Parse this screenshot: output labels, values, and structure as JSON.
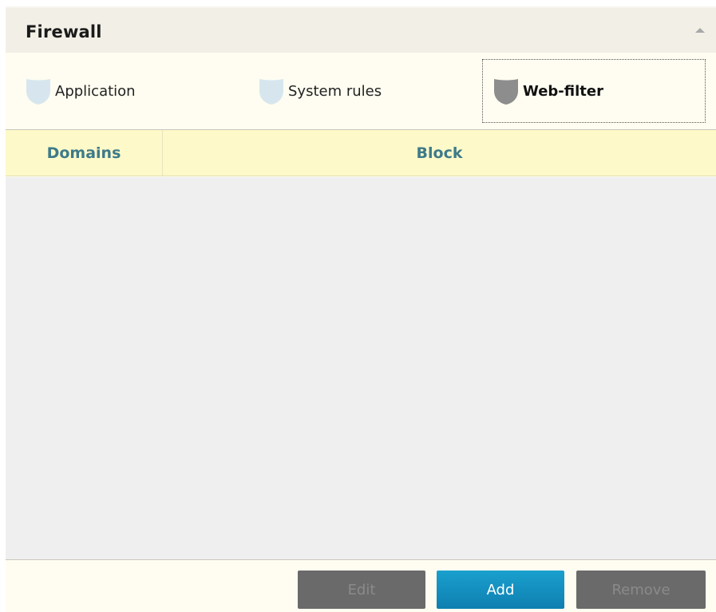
{
  "header": {
    "title": "Firewall"
  },
  "tabs": [
    {
      "label": "Application",
      "icon": "shield-icon",
      "active": false,
      "color": "#d7e6ee"
    },
    {
      "label": "System rules",
      "icon": "shield-icon",
      "active": false,
      "color": "#d7e6ee"
    },
    {
      "label": "Web-filter",
      "icon": "shield-icon",
      "active": true,
      "color": "#8d8d8d"
    }
  ],
  "table": {
    "columns": [
      "Domains",
      "Block"
    ],
    "rows": []
  },
  "buttons": {
    "edit": "Edit",
    "add": "Add",
    "remove": "Remove"
  },
  "colors": {
    "accent": "#1aa0ce",
    "header_bg": "#f2efe6",
    "table_header_bg": "#fdf9c9",
    "column_text": "#3e7a8a"
  }
}
